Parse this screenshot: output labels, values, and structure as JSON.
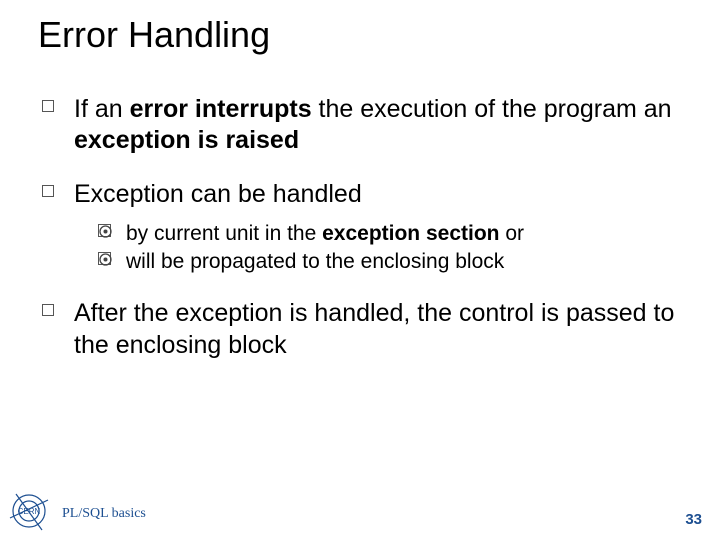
{
  "title": "Error Handling",
  "bullets": [
    {
      "parts": [
        {
          "t": "If an ",
          "b": false
        },
        {
          "t": "error",
          "b": true
        },
        {
          "t": " ",
          "b": false
        },
        {
          "t": "interrupts",
          "b": true
        },
        {
          "t": " the execution of the program an ",
          "b": false
        },
        {
          "t": "exception is raised",
          "b": true
        }
      ]
    },
    {
      "parts": [
        {
          "t": "Exception can be handled",
          "b": false
        }
      ],
      "sub": [
        {
          "parts": [
            {
              "t": "by current unit in the ",
              "b": false
            },
            {
              "t": "exception section",
              "b": true
            },
            {
              "t": " or",
              "b": false
            }
          ]
        },
        {
          "parts": [
            {
              "t": "will be propagated to the enclosing block",
              "b": false
            }
          ]
        }
      ]
    },
    {
      "parts": [
        {
          "t": "After the exception is handled, the control is passed to the enclosing block",
          "b": false
        }
      ]
    }
  ],
  "footer": {
    "text": "PL/SQL basics",
    "page": "33",
    "logo_label": "CERN"
  },
  "colors": {
    "accent": "#1d4f91"
  }
}
